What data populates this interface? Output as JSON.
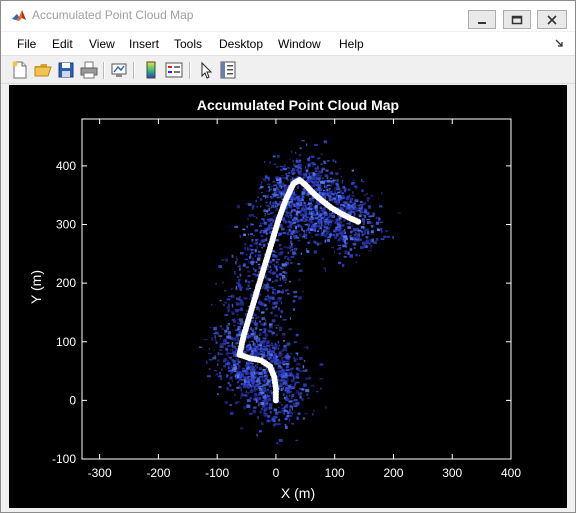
{
  "window": {
    "title": "Accumulated Point Cloud Map"
  },
  "menu": {
    "items": [
      "File",
      "Edit",
      "View",
      "Insert",
      "Tools",
      "Desktop",
      "Window",
      "Help"
    ]
  },
  "toolbar": {
    "icons": [
      "new-figure-icon",
      "open-file-icon",
      "save-icon",
      "print-icon",
      "link-plot-icon",
      "insert-colorbar-icon",
      "insert-legend-icon",
      "edit-plot-icon",
      "property-inspector-icon"
    ]
  },
  "colors": {
    "figure_background": "#000000",
    "point_cloud": "#3b50e8",
    "trajectory": "#ffffff",
    "axis": "#ffffff"
  },
  "chart_data": {
    "type": "scatter",
    "title": "Accumulated Point Cloud Map",
    "xlabel": "X (m)",
    "ylabel": "Y (m)",
    "xlim": [
      -330,
      400
    ],
    "ylim": [
      -100,
      480
    ],
    "xticks": [
      -300,
      -200,
      -100,
      0,
      100,
      200,
      300,
      400
    ],
    "yticks": [
      -100,
      0,
      100,
      200,
      300,
      400
    ],
    "grid": false,
    "series": [
      {
        "kind": "trajectory",
        "x": [
          0,
          0,
          -3,
          -10,
          -25,
          -45,
          -62,
          -55,
          -40,
          -25,
          -10,
          5,
          18,
          30,
          40,
          50,
          62,
          78,
          95,
          112,
          128,
          140
        ],
        "y": [
          0,
          20,
          40,
          58,
          68,
          72,
          78,
          110,
          160,
          210,
          260,
          310,
          345,
          370,
          376,
          368,
          355,
          341,
          328,
          318,
          310,
          305
        ]
      }
    ]
  }
}
